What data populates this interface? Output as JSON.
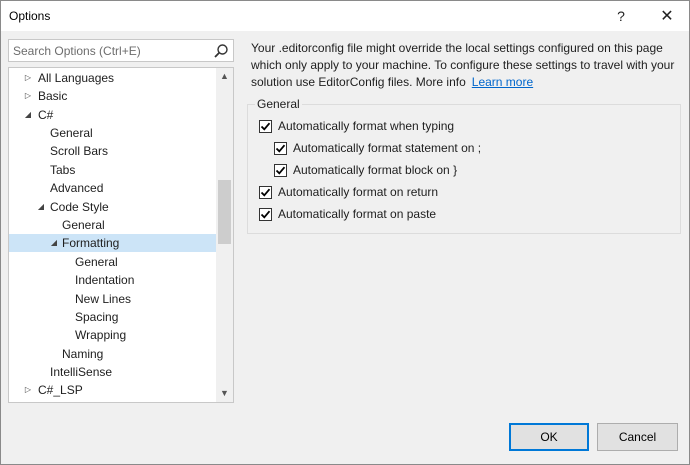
{
  "window": {
    "title": "Options",
    "help_glyph": "?",
    "close_glyph": "✕"
  },
  "search": {
    "placeholder": "Search Options (Ctrl+E)"
  },
  "tree": {
    "items": [
      {
        "label": "All Languages",
        "arrow": "▷"
      },
      {
        "label": "Basic",
        "arrow": "▷"
      },
      {
        "label": "C#",
        "arrow": "◢"
      },
      {
        "label": "General",
        "arrow": ""
      },
      {
        "label": "Scroll Bars",
        "arrow": ""
      },
      {
        "label": "Tabs",
        "arrow": ""
      },
      {
        "label": "Advanced",
        "arrow": ""
      },
      {
        "label": "Code Style",
        "arrow": "◢"
      },
      {
        "label": "General",
        "arrow": ""
      },
      {
        "label": "Formatting",
        "arrow": "◢"
      },
      {
        "label": "General",
        "arrow": ""
      },
      {
        "label": "Indentation",
        "arrow": ""
      },
      {
        "label": "New Lines",
        "arrow": ""
      },
      {
        "label": "Spacing",
        "arrow": ""
      },
      {
        "label": "Wrapping",
        "arrow": ""
      },
      {
        "label": "Naming",
        "arrow": ""
      },
      {
        "label": "IntelliSense",
        "arrow": ""
      },
      {
        "label": "C#_LSP",
        "arrow": "▷"
      }
    ]
  },
  "info": {
    "text": "Your .editorconfig file might override the local settings configured on this page which only apply to your machine. To configure these settings to travel with your solution use EditorConfig files. More info",
    "link": "Learn more"
  },
  "general_group": {
    "title": "General",
    "options": [
      {
        "label": "Automatically format when typing",
        "checked": true
      },
      {
        "label": "Automatically format statement on ;",
        "checked": true
      },
      {
        "label": "Automatically format block on }",
        "checked": true
      },
      {
        "label": "Automatically format on return",
        "checked": true
      },
      {
        "label": "Automatically format on paste",
        "checked": true
      }
    ]
  },
  "buttons": {
    "ok": "OK",
    "cancel": "Cancel"
  }
}
